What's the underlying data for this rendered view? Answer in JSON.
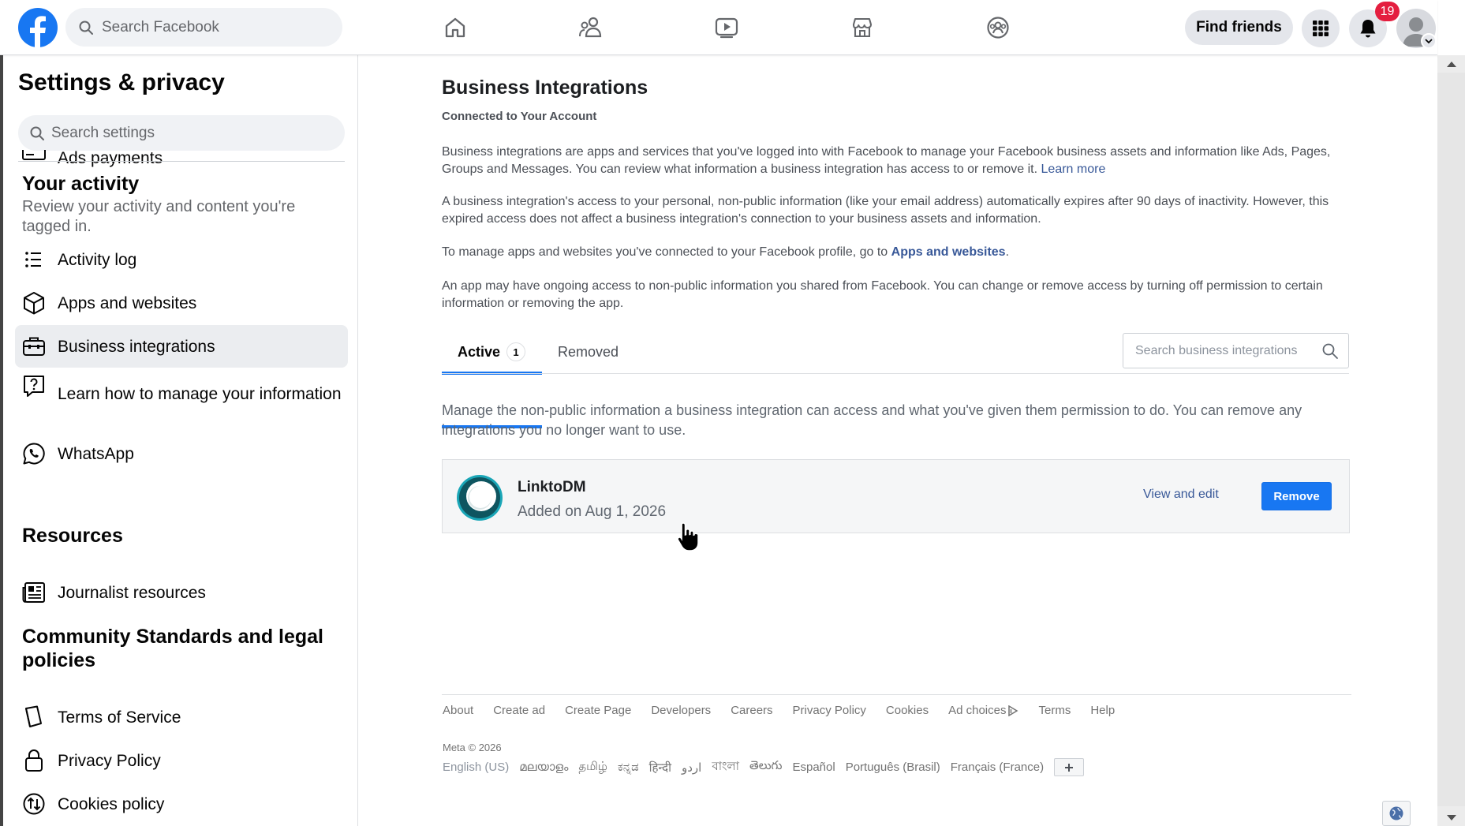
{
  "topbar": {
    "search_placeholder": "Search Facebook",
    "find_friends_label": "Find friends",
    "notification_count": "19",
    "nav_icons": [
      "home-icon",
      "friends-icon",
      "watch-icon",
      "marketplace-icon",
      "groups-icon"
    ],
    "brand_color": "#1877f2"
  },
  "sidebar": {
    "title": "Settings & privacy",
    "search_placeholder": "Search settings",
    "partial_item": "Ads payments",
    "your_activity": {
      "heading": "Your activity",
      "subtitle": "Review your activity and content you're tagged in.",
      "items": [
        {
          "label": "Activity log",
          "icon": "list-icon"
        },
        {
          "label": "Apps and websites",
          "icon": "cube-icon"
        },
        {
          "label": "Business integrations",
          "icon": "briefcase-icon",
          "active": true
        },
        {
          "label": "Learn how to manage your information",
          "icon": "help-chat-icon"
        },
        {
          "label": "WhatsApp",
          "icon": "whatsapp-icon"
        }
      ]
    },
    "resources": {
      "heading": "Resources",
      "items": [
        {
          "label": "Journalist resources",
          "icon": "newspaper-icon"
        }
      ]
    },
    "community": {
      "heading": "Community Standards and legal policies",
      "items": [
        {
          "label": "Terms of Service",
          "icon": "book-icon"
        },
        {
          "label": "Privacy Policy",
          "icon": "lock-icon"
        },
        {
          "label": "Cookies policy",
          "icon": "cookie-arrows-icon"
        }
      ]
    }
  },
  "main": {
    "title": "Business Integrations",
    "subtitle": "Connected to Your Account",
    "para1": "Business integrations are apps and services that you've logged into with Facebook to manage your Facebook business assets and information like Ads, Pages, Groups and Messages. You can review what information a business integration has access to or remove it.",
    "para1_link": "Learn more",
    "para2": "A business integration's access to your personal, non-public information (like your email address) automatically expires after 90 days of inactivity. However, this expired access does not affect a business integration's connection to your business assets and information.",
    "para3_prefix": "To manage apps and websites you've connected to your Facebook profile, go to",
    "para3_link": "Apps and websites",
    "para3_suffix": ".",
    "para4": "An app may have ongoing access to non-public information you shared from Facebook. You can change or remove access by turning off permission to certain information or removing the app.",
    "tabs": {
      "active_label": "Active",
      "active_count": "1",
      "removed_label": "Removed"
    },
    "search_placeholder": "Search business integrations",
    "manage_text": "Manage the non-public information a business integration can access and what you've given them permission to do. You can remove any integrations you no longer want to use.",
    "integration": {
      "name": "LinktoDM",
      "added": "Added on Aug 1, 2026",
      "view_edit_label": "View and edit",
      "remove_label": "Remove"
    }
  },
  "footer": {
    "links": [
      "About",
      "Create ad",
      "Create Page",
      "Developers",
      "Careers",
      "Privacy Policy",
      "Cookies",
      "Ad choices",
      "Terms",
      "Help"
    ],
    "copyright": "Meta © 2026",
    "current_language": "English (US)",
    "languages": [
      "മലയാളം",
      "தமிழ்",
      "ಕನ್ನಡ",
      "हिन्दी",
      "اردو",
      "বাংলা",
      "తెలుగు",
      "Español",
      "Português (Brasil)",
      "Français (France)"
    ]
  }
}
